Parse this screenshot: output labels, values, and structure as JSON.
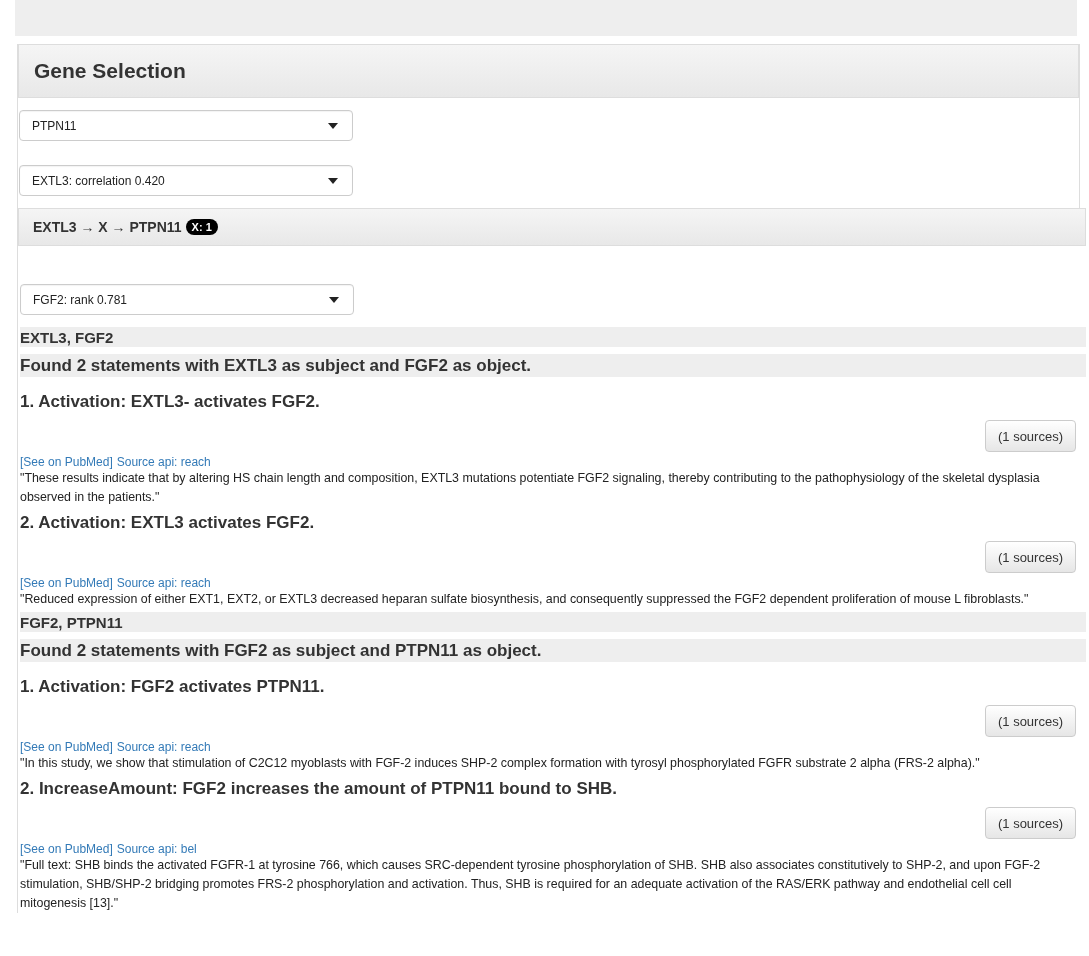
{
  "gene_selection": {
    "heading": "Gene Selection",
    "selects": [
      {
        "value": "PTPN11"
      },
      {
        "value": "EXTL3: correlation 0.420"
      }
    ]
  },
  "path_panel": {
    "heading": "EXTL3 → X → PTPN11",
    "badge": "X: 1",
    "select": {
      "value": "FGF2: rank 0.781"
    },
    "sections": [
      {
        "pair": "EXTL3, FGF2",
        "summary": "Found 2 statements with EXTL3 as subject and FGF2 as object.",
        "statements": [
          {
            "title": "1. Activation: EXTL3- activates FGF2.",
            "sources": "(1 sources)",
            "link": "[See on PubMed]",
            "source_api": "Source api: reach",
            "quote": "\"These results indicate that by altering HS chain length and composition, EXTL3 mutations potentiate FGF2 signaling, thereby contributing to the pathophysiology of the skeletal dysplasia observed in the patients.\""
          },
          {
            "title": "2. Activation: EXTL3 activates FGF2.",
            "sources": "(1 sources)",
            "link": "[See on PubMed]",
            "source_api": "Source api: reach",
            "quote": "\"Reduced expression of either EXT1, EXT2, or EXTL3 decreased heparan sulfate biosynthesis, and consequently suppressed the FGF2 dependent proliferation of mouse L fibroblasts.\""
          }
        ]
      },
      {
        "pair": "FGF2, PTPN11",
        "summary": "Found 2 statements with FGF2 as subject and PTPN11 as object.",
        "statements": [
          {
            "title": "1. Activation: FGF2 activates PTPN11.",
            "sources": "(1 sources)",
            "link": "[See on PubMed]",
            "source_api": "Source api: reach",
            "quote": "\"In this study, we show that stimulation of C2C12 myoblasts with FGF-2 induces SHP-2 complex formation with tyrosyl phosphorylated FGFR substrate 2 alpha (FRS-2 alpha).\""
          },
          {
            "title": "2. IncreaseAmount: FGF2 increases the amount of PTPN11 bound to SHB.",
            "sources": "(1 sources)",
            "link": "[See on PubMed]",
            "source_api": "Source api: bel",
            "quote": "\"Full text: SHB binds the activated FGFR-1 at tyrosine 766, which causes SRC-dependent tyrosine phosphorylation of SHB. SHB also associates constitutively to SHP-2, and upon FGF-2 stimulation, SHB/SHP-2 bridging promotes FRS-2 phosphorylation and activation. Thus, SHB is required for an adequate activation of the RAS/ERK pathway and endothelial cell cell mitogenesis [13].\""
          }
        ]
      }
    ]
  }
}
